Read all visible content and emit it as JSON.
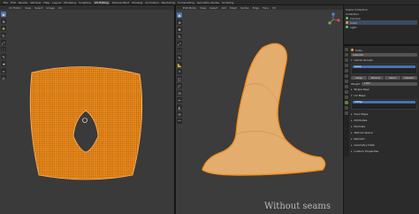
{
  "topbar": {
    "menus": [
      "File",
      "Edit",
      "Render",
      "Window",
      "Help"
    ],
    "workspaces": [
      "Layout",
      "Modeling",
      "Sculpting",
      "UV Editing",
      "Texture Paint",
      "Shading",
      "Animation",
      "Rendering",
      "Compositing",
      "Geometry Nodes",
      "Scripting"
    ],
    "active_workspace": "UV Editing"
  },
  "uv_editor": {
    "header_items": [
      "UV Editor",
      "View",
      "Select",
      "Image",
      "UV"
    ]
  },
  "viewport": {
    "header_items": [
      "Edit Mode",
      "View",
      "Select",
      "Add",
      "Mesh",
      "Vertex",
      "Edge",
      "Face",
      "UV"
    ],
    "caption": "Without seams"
  },
  "outliner": {
    "rows": [
      {
        "label": "Scene Collection",
        "dot": "none"
      },
      {
        "label": "Collection",
        "dot": "none"
      },
      {
        "label": "Camera",
        "dot": "green"
      },
      {
        "label": "Cube",
        "dot": "orange"
      },
      {
        "label": "Light",
        "dot": "green"
      }
    ]
  },
  "properties": {
    "object_name": "Cube",
    "mesh_name": "Cube.001",
    "sections": {
      "vertex_groups": "Vertex Groups",
      "shape_keys": "Shape Keys",
      "uv_maps": "UV Maps",
      "face_maps": "Face Maps",
      "attributes": "Attributes",
      "normals": "Normals",
      "texture_space": "Texture Space",
      "remesh": "Remesh",
      "geometry_data": "Geometry Data",
      "custom_properties": "Custom Properties",
      "color_attributes": "Color Attributes"
    },
    "vertex_group_item": "Group",
    "uv_map_item": "UVMap",
    "buttons": [
      "Assign",
      "Remove",
      "Select",
      "Deselect"
    ],
    "weight_label": "Weight",
    "weight_value": "1.000"
  },
  "colors": {
    "mesh_orange": "#f2901f",
    "accent_blue": "#4772b3"
  }
}
